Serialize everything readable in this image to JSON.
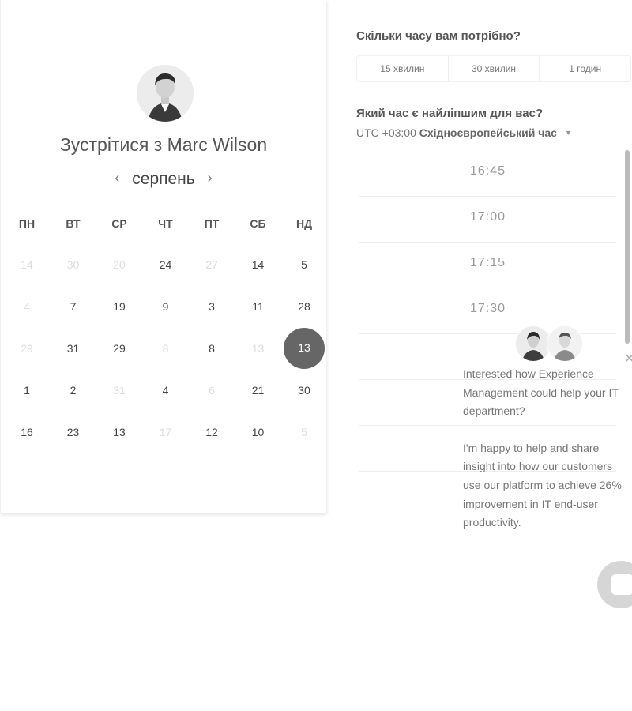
{
  "meeting": {
    "title_prefix": "Зустрітися з",
    "host_name": "Marc Wilson"
  },
  "calendar": {
    "month": "серпень",
    "prev_icon": "chevron-left-icon",
    "next_icon": "chevron-right-icon",
    "weekdays": [
      "ПН",
      "ВТ",
      "СР",
      "ЧТ",
      "ПТ",
      "СБ",
      "НД"
    ],
    "weeks": [
      [
        {
          "d": "14",
          "dis": true
        },
        {
          "d": "30",
          "dis": true
        },
        {
          "d": "20",
          "dis": true
        },
        {
          "d": "24"
        },
        {
          "d": "27",
          "dis": true
        },
        {
          "d": "14"
        },
        {
          "d": "5"
        }
      ],
      [
        {
          "d": "4",
          "dis": true
        },
        {
          "d": "7"
        },
        {
          "d": "19"
        },
        {
          "d": "9"
        },
        {
          "d": "3"
        },
        {
          "d": "11"
        },
        {
          "d": "28"
        }
      ],
      [
        {
          "d": "29",
          "dis": true
        },
        {
          "d": "31"
        },
        {
          "d": "29"
        },
        {
          "d": "8",
          "dis": true
        },
        {
          "d": "8"
        },
        {
          "d": "13",
          "dis": true
        },
        {
          "d": "13",
          "sel": true
        }
      ],
      [
        {
          "d": "1"
        },
        {
          "d": "2"
        },
        {
          "d": "31",
          "dis": true
        },
        {
          "d": "4"
        },
        {
          "d": "6",
          "dis": true
        },
        {
          "d": "21"
        },
        {
          "d": "30"
        }
      ],
      [
        {
          "d": "16"
        },
        {
          "d": "23"
        },
        {
          "d": "13"
        },
        {
          "d": "17",
          "dis": true
        },
        {
          "d": "12"
        },
        {
          "d": "10"
        },
        {
          "d": "5",
          "dis": true
        }
      ]
    ]
  },
  "duration": {
    "question": "Скільки часу вам потрібно?",
    "options": [
      "15 хвилин",
      "30 хвилин",
      "1 годин"
    ]
  },
  "time": {
    "question": "Який час є найліпшим для вас?",
    "tz_offset": "UTC +03:00",
    "tz_name": "Східноєвропейський час",
    "slots": [
      "16:45",
      "17:00",
      "17:15",
      "17:30"
    ]
  },
  "chat": {
    "message_1": "Interested how Experience Management could help your IT department?",
    "message_2": "I'm happy to help and share insight into how our customers use our platform to achieve 26% improvement in IT end-user productivity.",
    "close_icon": "close-icon",
    "launcher_icon": "chat-bubble-icon"
  },
  "colors": {
    "selected_day": "#666666",
    "text": "#555555",
    "muted": "#dddddd"
  }
}
